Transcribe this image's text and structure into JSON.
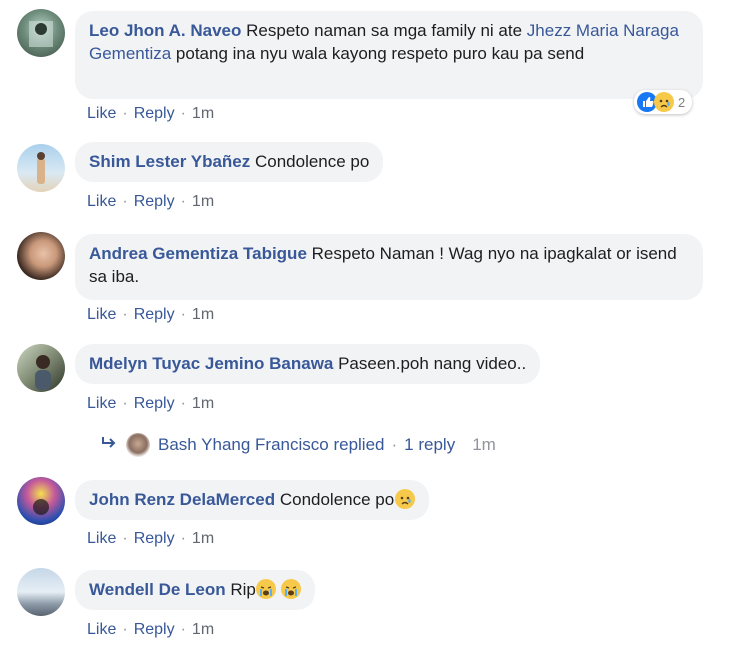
{
  "comments": [
    {
      "author": "Leo Jhon A. Naveo",
      "text_before": " Respeto naman sa mga family ni ate ",
      "tag": "Jhezz Maria Naraga Gementiza",
      "text_after": " potang ina nyu wala kayong respeto puro kau pa send",
      "actions": {
        "like": "Like",
        "reply": "Reply",
        "time": "1m"
      },
      "reaction_count": "2"
    },
    {
      "author": "Shim Lester Ybañez",
      "text": " Condolence po",
      "actions": {
        "like": "Like",
        "reply": "Reply",
        "time": "1m"
      }
    },
    {
      "author": "Andrea Gementiza Tabigue",
      "text": " Respeto Naman ! Wag nyo na ipagkalat or isend sa iba.",
      "actions": {
        "like": "Like",
        "reply": "Reply",
        "time": "1m"
      }
    },
    {
      "author": "Mdelyn Tuyac Jemino Banawa",
      "text": " Paseen.poh nang video..",
      "actions": {
        "like": "Like",
        "reply": "Reply",
        "time": "1m"
      },
      "reply_summary": {
        "replier": "Bash Yhang Francisco replied",
        "count": "1 reply",
        "time": "1m"
      }
    },
    {
      "author": "John Renz DelaMerced",
      "text": " Condolence po",
      "actions": {
        "like": "Like",
        "reply": "Reply",
        "time": "1m"
      }
    },
    {
      "author": "Wendell De Leon",
      "text": " Rip",
      "actions": {
        "like": "Like",
        "reply": "Reply",
        "time": "1m"
      }
    }
  ],
  "colors": {
    "link": "#385898",
    "bubble": "#f2f3f5",
    "text": "#1c1e21",
    "meta": "#90949c"
  }
}
